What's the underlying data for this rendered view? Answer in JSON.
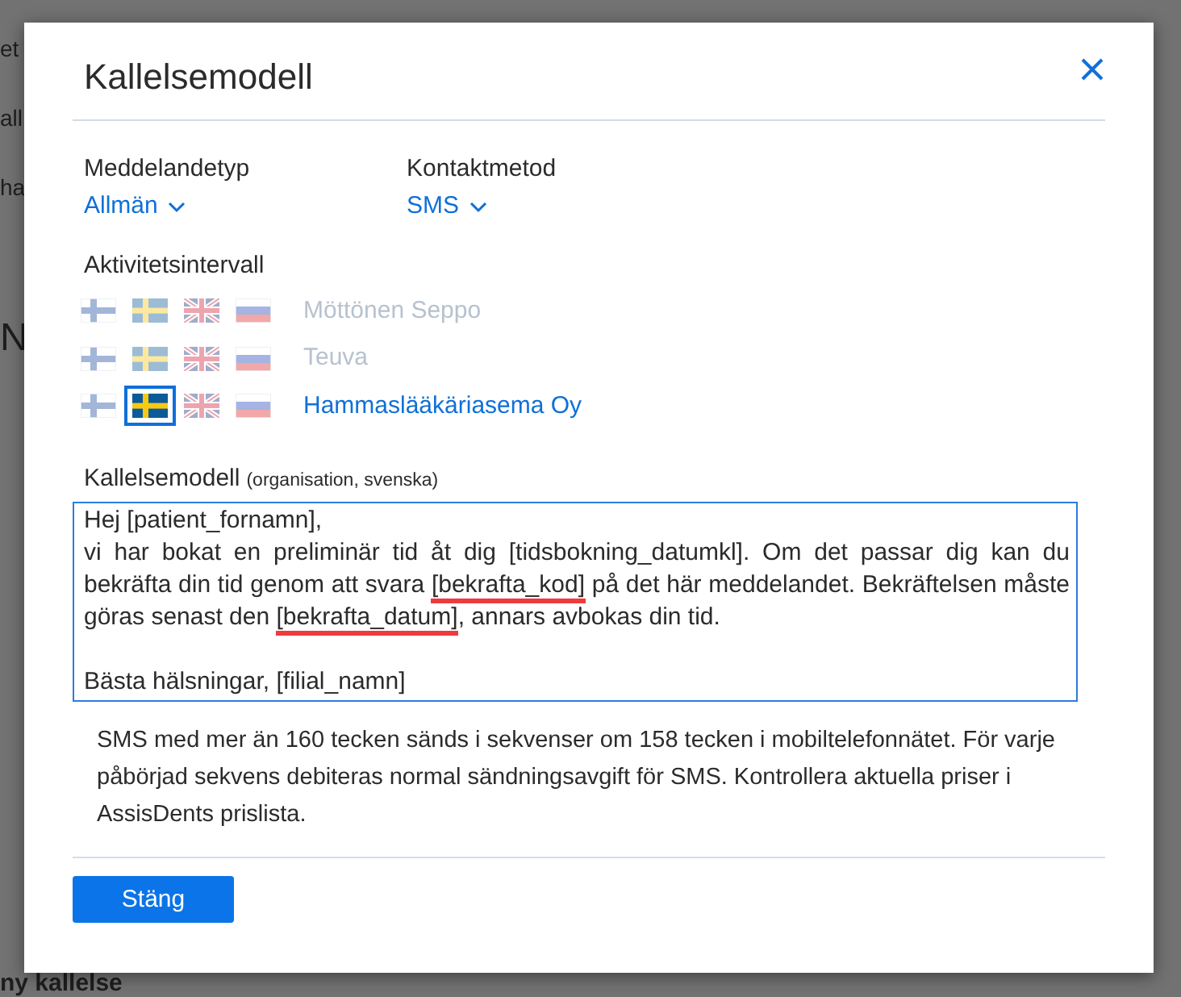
{
  "background": {
    "texts": [
      {
        "kind": "line",
        "text": "et"
      },
      {
        "kind": "line",
        "text": "all"
      },
      {
        "kind": "line",
        "text": "ha"
      },
      {
        "kind": "heading",
        "text": "N"
      },
      {
        "kind": "footer",
        "text": "ny kallelse"
      }
    ]
  },
  "dialog": {
    "title": "Kallelsemodell",
    "fields": [
      {
        "label": "Meddelandetyp",
        "value": "Allmän"
      },
      {
        "label": "Kontaktmetod",
        "value": "SMS"
      }
    ],
    "interval_label": "Aktivitetsintervall",
    "activities": [
      {
        "name": "Möttönen Seppo",
        "disabled": true,
        "languages": [
          {
            "kind": "fi",
            "selected": false
          },
          {
            "kind": "sv",
            "selected": false
          },
          {
            "kind": "en",
            "selected": false
          },
          {
            "kind": "ru",
            "selected": false
          }
        ]
      },
      {
        "name": "Teuva",
        "disabled": true,
        "languages": [
          {
            "kind": "fi",
            "selected": false
          },
          {
            "kind": "sv",
            "selected": false
          },
          {
            "kind": "en",
            "selected": false
          },
          {
            "kind": "ru",
            "selected": false
          }
        ]
      },
      {
        "name": "Hammaslääkäriasema Oy",
        "disabled": false,
        "languages": [
          {
            "kind": "fi",
            "selected": false
          },
          {
            "kind": "sv",
            "selected": true
          },
          {
            "kind": "en",
            "selected": false
          },
          {
            "kind": "ru",
            "selected": false
          }
        ]
      }
    ],
    "template": {
      "label": "Kallelsemodell",
      "label_note": "(organisation, svenska)",
      "paragraphs": [
        {
          "segments": [
            {
              "text": "Hej [patient_fornamn],",
              "flagged": false
            }
          ]
        },
        {
          "segments": [
            {
              "text": "vi har bokat en preliminär tid åt dig [tidsbokning_datumkl]. Om det passar dig kan du bekräfta din tid genom att svara ",
              "flagged": false
            },
            {
              "text": "[bekrafta_kod]",
              "flagged": true
            },
            {
              "text": " på det här meddelandet. Bekräftelsen måste göras senast den ",
              "flagged": false
            },
            {
              "text": "[bekrafta_datum]",
              "flagged": true
            },
            {
              "text": ", annars avbokas din tid.",
              "flagged": false
            }
          ]
        },
        {
          "segments": [
            {
              "text": "Bästa hälsningar, [filial_namn]",
              "flagged": false
            }
          ]
        }
      ]
    },
    "note": "SMS med mer än 160 tecken sänds i sekvenser om 158 tecken i mobiltelefonnätet. För varje påbörjad sekvens debiteras normal sändningsavgift för SMS. Kontrollera aktuella priser i AssisDents prislista.",
    "buttons": [
      {
        "label": "Stäng"
      }
    ]
  }
}
